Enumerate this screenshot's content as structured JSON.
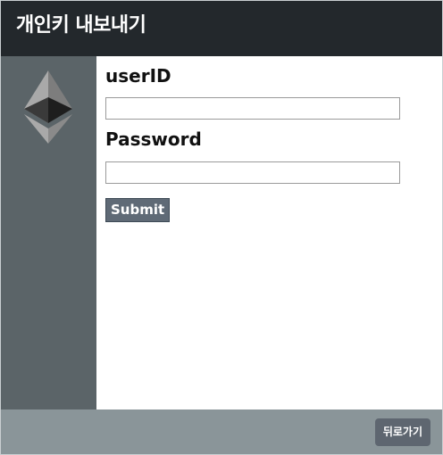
{
  "header": {
    "title": "개인키 내보내기"
  },
  "form": {
    "userid_label": "userID",
    "userid_value": "",
    "password_label": "Password",
    "password_value": "",
    "submit_label": "Submit"
  },
  "footer": {
    "back_label": "뒤로가기"
  },
  "colors": {
    "header_bg": "#23282c",
    "sidebar_bg": "#5b6468",
    "footer_bg": "#8a9599",
    "button_bg": "#5f6a76"
  },
  "icons": {
    "sidebar_logo": "ethereum-logo-icon"
  }
}
